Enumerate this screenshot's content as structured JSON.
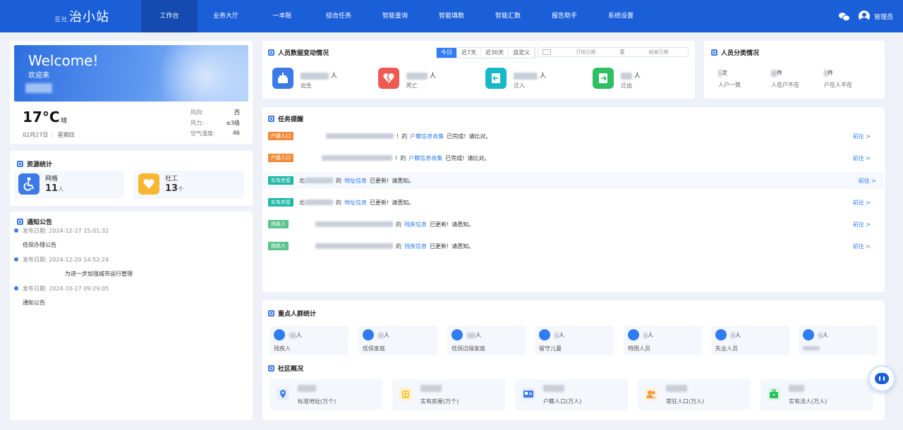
{
  "app": {
    "logo_prefix": "区社",
    "logo_title": "治小站"
  },
  "nav": {
    "items": [
      "工作台",
      "业务大厅",
      "一本账",
      "综合任务",
      "智能查询",
      "智能填数",
      "智能汇数",
      "报告助手",
      "系统设置"
    ],
    "active_index": 0,
    "user": "管理员"
  },
  "welcome": {
    "title": "Welcome!",
    "subtitle": "欢迎来"
  },
  "weather": {
    "temp": "17°C",
    "condition": "晴",
    "date": "02月27日",
    "weekday": "星期四",
    "rows": [
      {
        "label": "风向:",
        "value": "西"
      },
      {
        "label": "风力:",
        "value": "≤3级"
      },
      {
        "label": "空气湿度:",
        "value": "46"
      }
    ]
  },
  "resources": {
    "title": "资源统计",
    "items": [
      {
        "label": "网格",
        "value": "11",
        "unit": "人",
        "color": "#3c7ae8"
      },
      {
        "label": "社工",
        "value": "13",
        "unit": "个",
        "color": "#f7b731"
      }
    ]
  },
  "notices": {
    "title": "通知公告",
    "items": [
      {
        "date": "发布日期: 2024-12-27 15:01:32",
        "text": "低保办理公告"
      },
      {
        "date": "发布日期: 2024-12-20 14:52:24",
        "text": "为进一步加强城市运行管理"
      },
      {
        "date": "发布日期: 2024-10-27 09:29:05",
        "text": "通知公告"
      }
    ]
  },
  "changes": {
    "title": "人员数据变动情况",
    "tabs": [
      "今日",
      "近7天",
      "近30天",
      "自定义"
    ],
    "active_tab": 0,
    "start_placeholder": "开始日期",
    "range_sep": "至",
    "end_placeholder": "结束日期",
    "items": [
      {
        "unit": "人",
        "label": "出生",
        "color": "#3c7ae8"
      },
      {
        "unit": "人",
        "label": "死亡",
        "color": "#ee5a52"
      },
      {
        "unit": "人",
        "label": "迁入",
        "color": "#19b8c9"
      },
      {
        "unit": "人",
        "label": "迁出",
        "color": "#2fbf63"
      }
    ]
  },
  "classification": {
    "title": "人员分类情况",
    "items": [
      {
        "unit": "次",
        "label": "人户一致"
      },
      {
        "unit": "件",
        "label": "人在户不在"
      },
      {
        "unit": "件",
        "label": "户在人不在"
      }
    ]
  },
  "tasks": {
    "title": "任务提醒",
    "go_label": "前往 >",
    "rows": [
      {
        "tag": "户籍人口",
        "tag_color": "o",
        "prefix": "!",
        "of": "的",
        "link": "户籍信息收集",
        "status": "已完成!",
        "note": "请比对。"
      },
      {
        "tag": "户籍人口",
        "tag_color": "o",
        "prefix": "!",
        "of": "的",
        "link": "户籍信息收集",
        "status": "已完成!",
        "note": "请比对。"
      },
      {
        "tag": "实有房屋",
        "tag_color": "g",
        "prefix": "北",
        "of": "的",
        "link": "地址信息",
        "status": "已更新!",
        "note": "请悉知。"
      },
      {
        "tag": "实有房屋",
        "tag_color": "g",
        "prefix": "北",
        "of": "的",
        "link": "地址信息",
        "status": "已更新!",
        "note": "请悉知。"
      },
      {
        "tag": "残疾人",
        "tag_color": "n",
        "prefix": "",
        "of": "的",
        "link": "残疾信息",
        "status": "已更新!",
        "note": "请悉知。"
      },
      {
        "tag": "残疾人",
        "tag_color": "n",
        "prefix": "",
        "of": "的",
        "link": "残疾信息",
        "status": "已更新!",
        "note": "请悉知。"
      }
    ]
  },
  "key_groups": {
    "title": "重点人群统计",
    "items": [
      {
        "unit": "人",
        "label": "残疾人"
      },
      {
        "unit": "人",
        "label": "低保家庭"
      },
      {
        "unit": "人",
        "label": "低保边缘家庭"
      },
      {
        "unit": "人",
        "label": "留守儿童"
      },
      {
        "unit": "人",
        "label": "特困人员"
      },
      {
        "unit": "人",
        "label": "失业人员"
      },
      {
        "unit": "人",
        "label": ""
      }
    ]
  },
  "community": {
    "title": "社区概况",
    "items": [
      {
        "label": "标准地址(万个)",
        "color": "#3c7ae8"
      },
      {
        "label": "实有房屋(万个)",
        "color": "#f7c948"
      },
      {
        "label": "户籍人口(万人)",
        "color": "#3c7ae8"
      },
      {
        "label": "常驻人口(万人)",
        "color": "#f39c35"
      },
      {
        "label": "实有法人(万人)",
        "color": "#2fbf63"
      }
    ]
  }
}
